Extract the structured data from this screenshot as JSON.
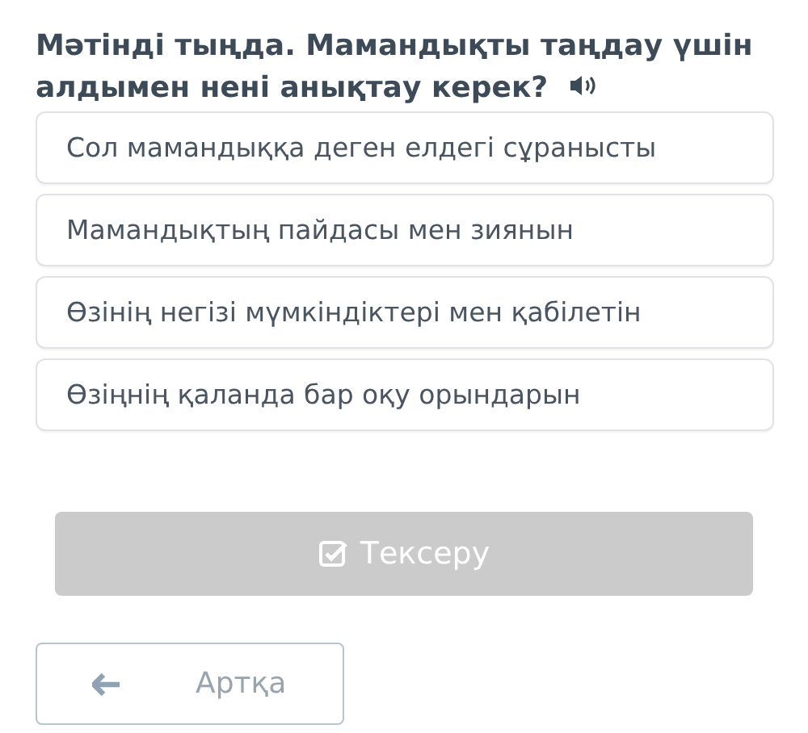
{
  "question": {
    "text": "Мәтінді тыңда. Мамандықты таңдау үшін алдымен нені анықтау керек?"
  },
  "options": [
    {
      "label": "Сол мамандыққа деген елдегі сұранысты"
    },
    {
      "label": "Мамандықтың пайдасы мен зиянын"
    },
    {
      "label": "Өзінің негізі мүмкіндіктері мен қабілетін"
    },
    {
      "label": "Өзіңнің қаланда бар оқу орындарын"
    }
  ],
  "check_button": {
    "label": "Тексеру",
    "disabled": true
  },
  "back_button": {
    "label": "Артқа"
  }
}
